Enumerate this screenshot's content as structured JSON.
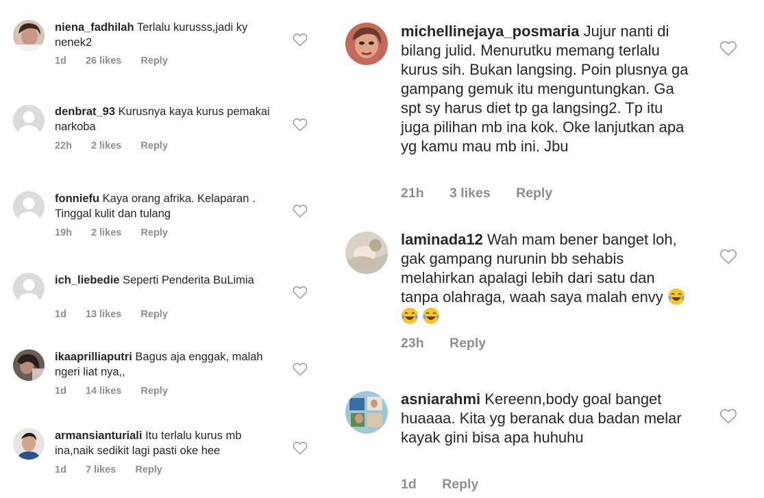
{
  "left_comments": [
    {
      "username": "niena_fadhilah",
      "text": "Terlalu kurusss,jadi ky nenek2",
      "time": "1d",
      "likes": "26 likes",
      "reply": "Reply",
      "avatar": "photo"
    },
    {
      "username": "denbrat_93",
      "text": "Kurusnya kaya kurus pemakai narkoba",
      "time": "22h",
      "likes": "2 likes",
      "reply": "Reply",
      "avatar": "default"
    },
    {
      "username": "fonniefu",
      "text": "Kaya orang afrika. Kelaparan . Tinggal kulit dan tulang",
      "time": "19h",
      "likes": "2 likes",
      "reply": "Reply",
      "avatar": "default"
    },
    {
      "username": "ich_liebedie",
      "text": "Seperti Penderita BuLimia",
      "time": "1d",
      "likes": "13 likes",
      "reply": "Reply",
      "avatar": "default"
    },
    {
      "username": "ikaaprilliaputri",
      "text": "Bagus aja enggak, malah ngeri liat nya,,",
      "time": "1d",
      "likes": "14 likes",
      "reply": "Reply",
      "avatar": "photo"
    },
    {
      "username": "armansianturiali",
      "text": "Itu terlalu kurus mb ina,naik sedikit lagi pasti oke hee",
      "time": "1d",
      "likes": "7 likes",
      "reply": "Reply",
      "avatar": "photo"
    }
  ],
  "right_comments": [
    {
      "username": "michellinejaya_posmaria",
      "text": "Jujur nanti di bilang julid. Menurutku memang terlalu kurus sih. Bukan langsing. Poin plusnya ga gampang gemuk itu menguntungkan. Ga spt sy harus diet tp ga langsing2. Tp itu juga pilihan mb ina kok. Oke lanjutkan apa yg kamu mau mb ini. Jbu",
      "time": "21h",
      "likes": "3 likes",
      "reply": "Reply",
      "avatar": "photo"
    },
    {
      "username": "laminada12",
      "text": "Wah mam bener banget loh, gak gampang nurunin bb sehabis melahirkan apalagi lebih dari satu dan tanpa olahraga, waah saya malah envy",
      "emoji": [
        "😂",
        "😂",
        "😂"
      ],
      "time": "23h",
      "likes": "",
      "reply": "Reply",
      "avatar": "photo"
    },
    {
      "username": "asniarahmi",
      "text": "Kereenn,body goal banget huaaaa. Kita yg beranak dua badan melar kayak gini bisa apa huhuhu",
      "time": "1d",
      "likes": "",
      "reply": "Reply",
      "avatar": "photo"
    }
  ],
  "icons": {
    "like": "heart-outline-icon",
    "default_avatar": "person-silhouette-icon",
    "emoji": "tears-of-joy-emoji"
  },
  "colors": {
    "text": "#262626",
    "meta": "#8e8e8e",
    "icon": "#999999",
    "avatar_default_bg": "#dbdbdb"
  }
}
